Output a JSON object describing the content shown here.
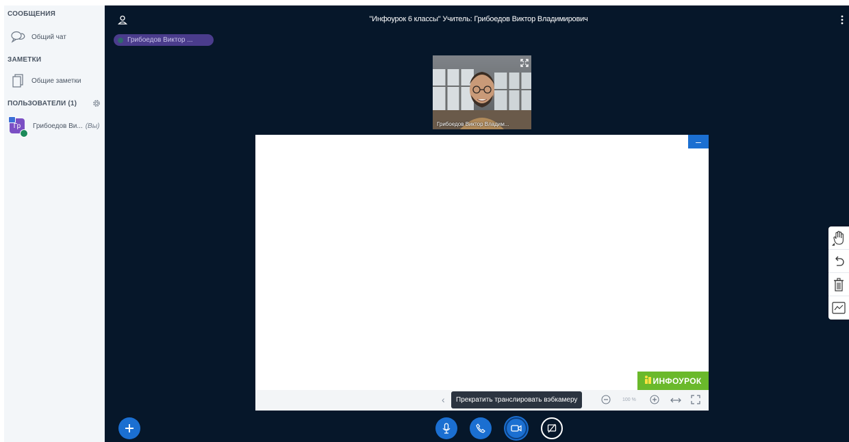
{
  "sidebar": {
    "messages_heading": "СООБЩЕНИЯ",
    "public_chat_label": "Общий чат",
    "notes_heading": "ЗАМЕТКИ",
    "shared_notes_label": "Общие заметки",
    "users_heading": "ПОЛЬЗОВАТЕЛИ (1)",
    "users": [
      {
        "avatar_initials": "Гр",
        "name": "Грибоедов Ви...",
        "you_label": "(Вы)"
      }
    ]
  },
  "header": {
    "title": "\"Инфоурок 6 классы\" Учитель: Грибоедов Виктор Владимирович",
    "talking_indicator": "Грибоедов Виктор ..."
  },
  "video": {
    "participant_name": "Грибоедов Виктор Владим..."
  },
  "presentation": {
    "minimize_label": "–",
    "logo_text": "ИНФОУРОК",
    "zoom_level": "100 %",
    "tooltip": "Прекратить транслировать вэбкамеру"
  },
  "tools": [
    "hand-icon",
    "undo-icon",
    "trash-icon",
    "multi-user-whiteboard-icon"
  ],
  "colors": {
    "main_bg": "#06172a",
    "accent": "#1b6fd1",
    "sidebar_bg": "#f3f6f9",
    "logo_green": "#6ab92b",
    "talker_pill": "#4a3c8c"
  }
}
